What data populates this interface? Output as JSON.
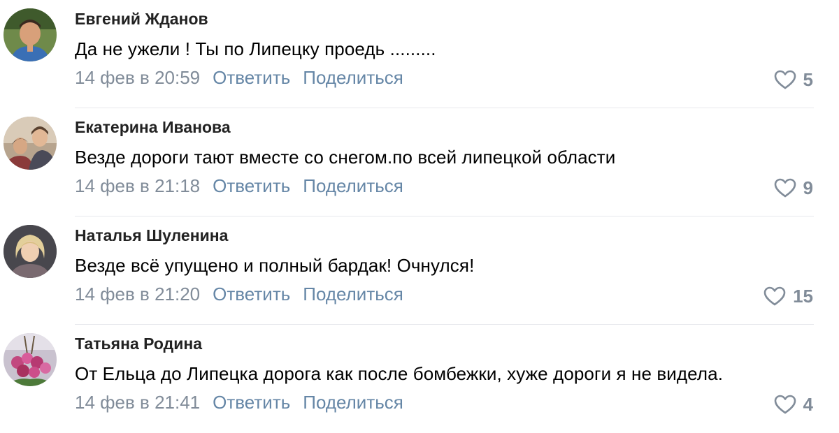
{
  "comments": [
    {
      "author": "Евгений Жданов",
      "text": "Да не ужели ! Ты по Липецку проедь .........",
      "date": "14 фев в 20:59",
      "reply_label": "Ответить",
      "share_label": "Поделиться",
      "likes": "5"
    },
    {
      "author": "Екатерина Иванова",
      "text": "Везде дороги тают вместе со снегом.по всей липецкой области",
      "date": "14 фев в 21:18",
      "reply_label": "Ответить",
      "share_label": "Поделиться",
      "likes": "9"
    },
    {
      "author": "Наталья Шуленина",
      "text": "Везде всё упущено и полный бардак! Очнулся!",
      "date": "14 фев в 21:20",
      "reply_label": "Ответить",
      "share_label": "Поделиться",
      "likes": "15"
    },
    {
      "author": "Татьяна Родина",
      "text": "От Ельца до Липецка дорога как после бомбежки, хуже дороги я не видела.",
      "date": "14 фев в 21:41",
      "reply_label": "Ответить",
      "share_label": "Поделиться",
      "likes": "4"
    }
  ],
  "colors": {
    "link": "#2a5885",
    "meta": "#818c99",
    "divider": "#e7e8ec"
  },
  "icons": {
    "like": "heart-outline-icon"
  }
}
